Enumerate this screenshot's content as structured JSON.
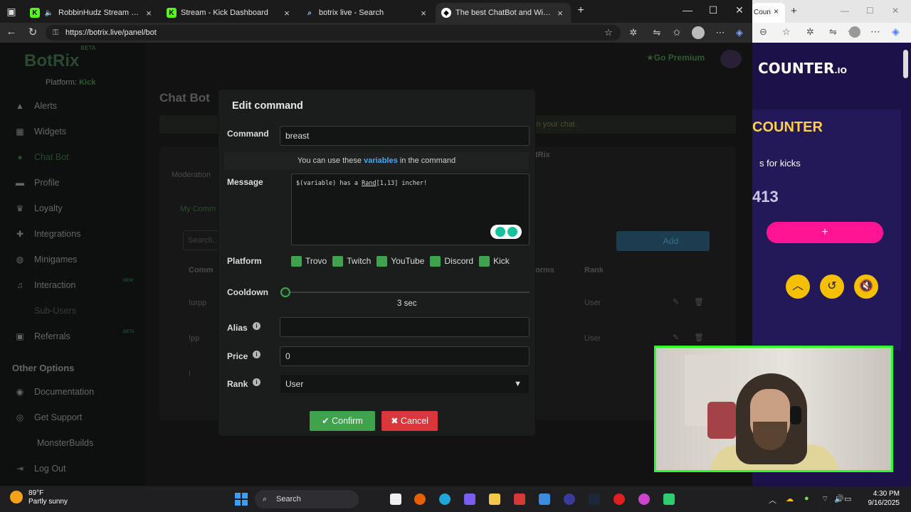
{
  "browser": {
    "tabs": [
      {
        "label": "RobbinHudz Stream - Watch",
        "icon": "kick-icon",
        "close": "×"
      },
      {
        "label": "Stream - Kick Dashboard",
        "icon": "kick-icon",
        "close": "×"
      },
      {
        "label": "botrix live - Search",
        "icon": "search-icon",
        "close": "×"
      },
      {
        "label": "The best ChatBot and Widgets fo",
        "icon": "botrix-icon",
        "close": "×"
      }
    ],
    "new_tab": "+",
    "url": "https://botrix.live/panel/bot",
    "right_tab_label": "Coun"
  },
  "sidebar": {
    "logo": "BotRix",
    "beta": "BETA",
    "platform_label": "Platform:",
    "platform_value": "Kick",
    "items": [
      {
        "label": "Alerts",
        "icon": "bell-icon"
      },
      {
        "label": "Widgets",
        "icon": "widgets-icon"
      },
      {
        "label": "Chat Bot",
        "icon": "chat-icon"
      },
      {
        "label": "Profile",
        "icon": "user-icon"
      },
      {
        "label": "Loyalty",
        "icon": "trophy-icon"
      },
      {
        "label": "Integrations",
        "icon": "puzzle-icon"
      },
      {
        "label": "Minigames",
        "icon": "gamepad-icon"
      },
      {
        "label": "Interaction",
        "icon": "music-icon",
        "tag": "NEW"
      },
      {
        "label": "Sub-Users",
        "icon": "users-icon"
      },
      {
        "label": "Referrals",
        "icon": "referral-icon",
        "tag": "BETA"
      }
    ],
    "section_title": "Other Options",
    "other_items": [
      {
        "label": "Documentation",
        "icon": "docs-icon"
      },
      {
        "label": "Get Support",
        "icon": "support-icon"
      },
      {
        "label": "MonsterBuilds",
        "icon": "monster-icon"
      },
      {
        "label": "Log Out",
        "icon": "logout-icon"
      }
    ]
  },
  "page": {
    "title": "Chat Bot",
    "go_premium": "Go Premium",
    "info_text": "in your chat.",
    "tab_moderation": "Moderation",
    "my_commands": "My Comm",
    "search_placeholder": "Search...",
    "add_button": "Add",
    "col_command": "Comm",
    "col_platforms": "orms",
    "col_rank": "Rank",
    "partial_header": "tRix",
    "rows": [
      {
        "command": "!urpp",
        "rank": "User"
      },
      {
        "command": "!pp",
        "rank": "User"
      },
      {
        "command": "!",
        "rank": ""
      }
    ]
  },
  "modal": {
    "title": "Edit command",
    "command_label": "Command",
    "command_value": "breast",
    "variables_hint_pre": "You can use these",
    "variables_link": "variables",
    "variables_hint_post": "in the command",
    "message_label": "Message",
    "message_pre": "$(variable) has a ",
    "message_link": "Rand",
    "message_post": "[1,13] incher!",
    "platform_label": "Platform",
    "platforms": [
      "Trovo",
      "Twitch",
      "YouTube",
      "Discord",
      "Kick"
    ],
    "cooldown_label": "Cooldown",
    "cooldown_value": "3 sec",
    "alias_label": "Alias",
    "alias_value": "",
    "price_label": "Price",
    "price_value": "0",
    "rank_label": "Rank",
    "rank_value": "User",
    "confirm": "Confirm",
    "cancel": "Cancel"
  },
  "kickcounter": {
    "logo": "KICKCOUNTER.IO",
    "logo_visible": "COUNTER",
    "logo_suffix": ".IO",
    "title": "COUNTER",
    "subtitle": "s for kicks",
    "count": "413",
    "plus": "+"
  },
  "taskbar": {
    "temp": "89°F",
    "weather": "Partly sunny",
    "search": "Search",
    "time": "4:30 PM",
    "date": "9/16/2025"
  },
  "colors": {
    "accent_green": "#3fa34d",
    "cancel_red": "#d9373c",
    "link_blue": "#4aa6e8",
    "kc_pink": "#ff1493",
    "kc_yellow": "#ffd04a"
  }
}
